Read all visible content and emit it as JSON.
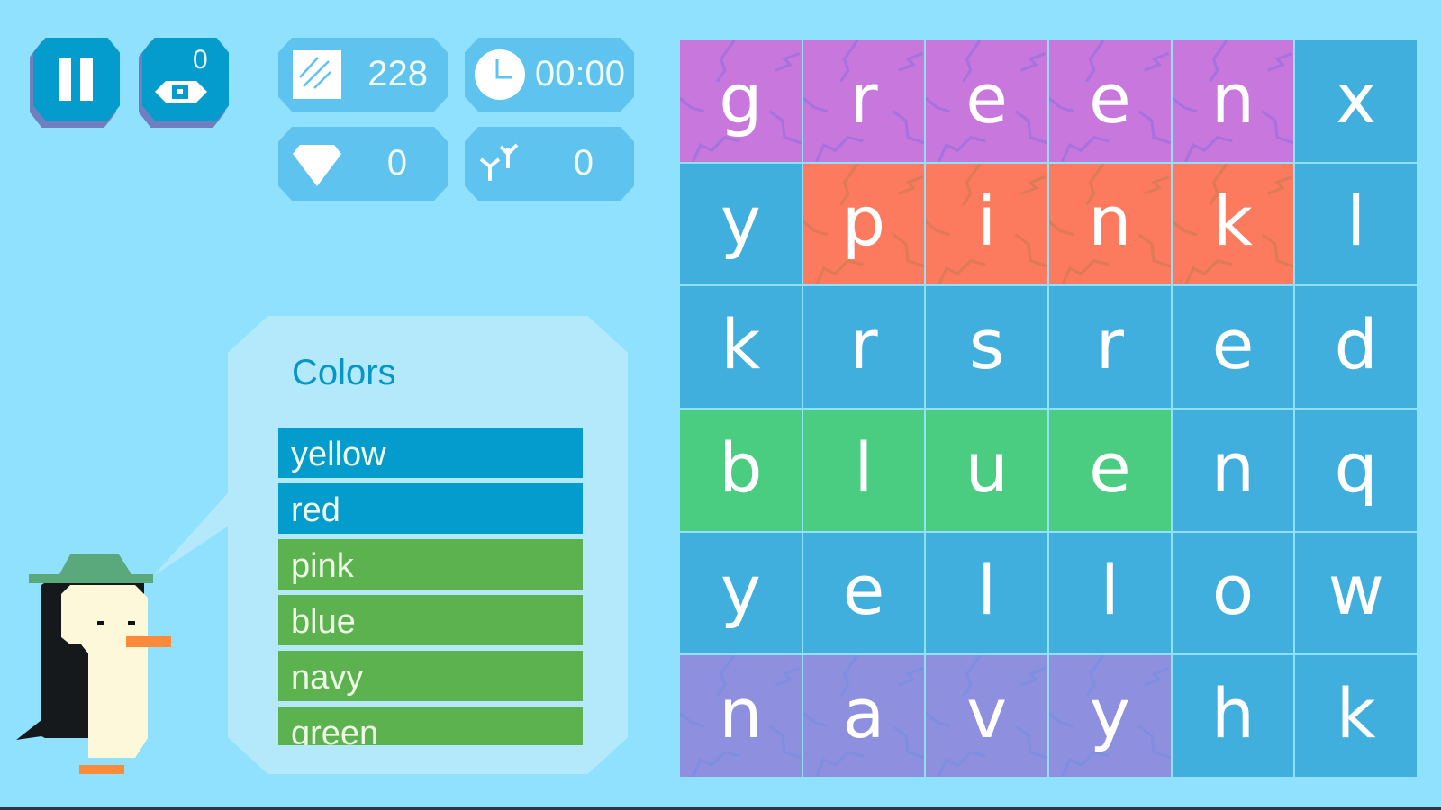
{
  "controls": {
    "pause_label": "Pause",
    "hint_label": "Hint",
    "hint_count": "0"
  },
  "stats": {
    "score": "228",
    "timer": "00:00",
    "gems": "0",
    "branches": "0"
  },
  "word_list": {
    "title": "Colors",
    "words": [
      {
        "text": "yellow",
        "status": "remaining"
      },
      {
        "text": "red",
        "status": "remaining"
      },
      {
        "text": "pink",
        "status": "found"
      },
      {
        "text": "blue",
        "status": "found"
      },
      {
        "text": "navy",
        "status": "found"
      },
      {
        "text": "green",
        "status": "found"
      }
    ]
  },
  "colors": {
    "background": "#8fe1fd",
    "button": "#049bcd",
    "button_shadow": "#6f7fbf",
    "stat_panel": "#5ec4ef",
    "bubble": "#b3e9fb",
    "word_remaining": "#049bcd",
    "word_found": "#5cb24f",
    "cell_default": "#40afdd",
    "found_green": "#c877dd",
    "found_pink": "#fc7a5d",
    "found_blue": "#4acd81",
    "found_navy": "#8f8fe0"
  },
  "grid": {
    "rows": [
      [
        {
          "l": "g",
          "c": "found_green",
          "k": 1
        },
        {
          "l": "r",
          "c": "found_green",
          "k": 1
        },
        {
          "l": "e",
          "c": "found_green",
          "k": 1
        },
        {
          "l": "e",
          "c": "found_green",
          "k": 1
        },
        {
          "l": "n",
          "c": "found_green",
          "k": 1
        },
        {
          "l": "x",
          "c": "cell_default",
          "k": 0
        }
      ],
      [
        {
          "l": "y",
          "c": "cell_default",
          "k": 0
        },
        {
          "l": "p",
          "c": "found_pink",
          "k": 1
        },
        {
          "l": "i",
          "c": "found_pink",
          "k": 1
        },
        {
          "l": "n",
          "c": "found_pink",
          "k": 1
        },
        {
          "l": "k",
          "c": "found_pink",
          "k": 1
        },
        {
          "l": "l",
          "c": "cell_default",
          "k": 0
        }
      ],
      [
        {
          "l": "k",
          "c": "cell_default",
          "k": 0
        },
        {
          "l": "r",
          "c": "cell_default",
          "k": 0
        },
        {
          "l": "s",
          "c": "cell_default",
          "k": 0
        },
        {
          "l": "r",
          "c": "cell_default",
          "k": 0
        },
        {
          "l": "e",
          "c": "cell_default",
          "k": 0
        },
        {
          "l": "d",
          "c": "cell_default",
          "k": 0
        }
      ],
      [
        {
          "l": "b",
          "c": "found_blue",
          "k": 0
        },
        {
          "l": "l",
          "c": "found_blue",
          "k": 0
        },
        {
          "l": "u",
          "c": "found_blue",
          "k": 0
        },
        {
          "l": "e",
          "c": "found_blue",
          "k": 0
        },
        {
          "l": "n",
          "c": "cell_default",
          "k": 0
        },
        {
          "l": "q",
          "c": "cell_default",
          "k": 0
        }
      ],
      [
        {
          "l": "y",
          "c": "cell_default",
          "k": 0
        },
        {
          "l": "e",
          "c": "cell_default",
          "k": 0
        },
        {
          "l": "l",
          "c": "cell_default",
          "k": 0
        },
        {
          "l": "l",
          "c": "cell_default",
          "k": 0
        },
        {
          "l": "o",
          "c": "cell_default",
          "k": 0
        },
        {
          "l": "w",
          "c": "cell_default",
          "k": 0
        }
      ],
      [
        {
          "l": "n",
          "c": "found_navy",
          "k": 1
        },
        {
          "l": "a",
          "c": "found_navy",
          "k": 1
        },
        {
          "l": "v",
          "c": "found_navy",
          "k": 1
        },
        {
          "l": "y",
          "c": "found_navy",
          "k": 1
        },
        {
          "l": "h",
          "c": "cell_default",
          "k": 0
        },
        {
          "l": "k",
          "c": "cell_default",
          "k": 0
        }
      ]
    ]
  }
}
